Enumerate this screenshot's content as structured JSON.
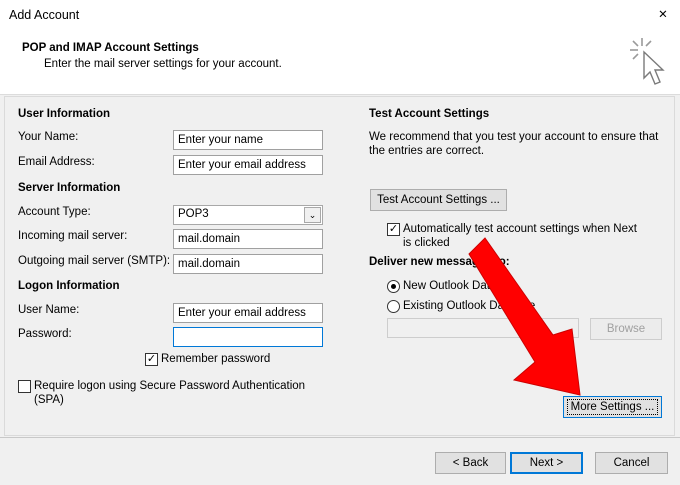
{
  "window": {
    "title": "Add Account",
    "close_glyph": "✕"
  },
  "header": {
    "title": "POP and IMAP Account Settings",
    "subtitle": "Enter the mail server settings for your account.",
    "icon": "cursor-click-icon"
  },
  "user_info": {
    "heading": "User Information",
    "your_name_label": "Your Name:",
    "your_name_value": "Enter your name",
    "email_label": "Email Address:",
    "email_value": "Enter your email address"
  },
  "server_info": {
    "heading": "Server Information",
    "account_type_label": "Account Type:",
    "account_type_value": "POP3",
    "incoming_label": "Incoming mail server:",
    "incoming_value": "mail.domain",
    "outgoing_label": "Outgoing mail server (SMTP):",
    "outgoing_value": "mail.domain"
  },
  "logon_info": {
    "heading": "Logon Information",
    "username_label": "User Name:",
    "username_value": "Enter your email address",
    "password_label": "Password:",
    "password_value": "",
    "remember_label": "Remember password",
    "remember_checked": true,
    "spa_label_line1": "Require logon using Secure Password Authentication",
    "spa_label_line2": "(SPA)",
    "spa_checked": false
  },
  "test_settings": {
    "heading": "Test Account Settings",
    "description_line1": "We recommend that you test your account to ensure that",
    "description_line2": "the entries are correct.",
    "test_button": "Test Account Settings ...",
    "auto_test_line1": "Automatically test account settings when Next",
    "auto_test_line2": "is clicked",
    "auto_test_checked": true
  },
  "deliver": {
    "heading": "Deliver new messages to:",
    "new_option": "New Outlook Data File",
    "existing_option": "Existing Outlook Data File",
    "selected": "new",
    "browse_button": "Browse"
  },
  "more_settings_button": "More Settings ...",
  "footer": {
    "back_button": "< Back",
    "next_button": "Next >",
    "cancel_button": "Cancel"
  },
  "colors": {
    "annotation_arrow": "#ff0000",
    "focus_border": "#0078d7"
  }
}
